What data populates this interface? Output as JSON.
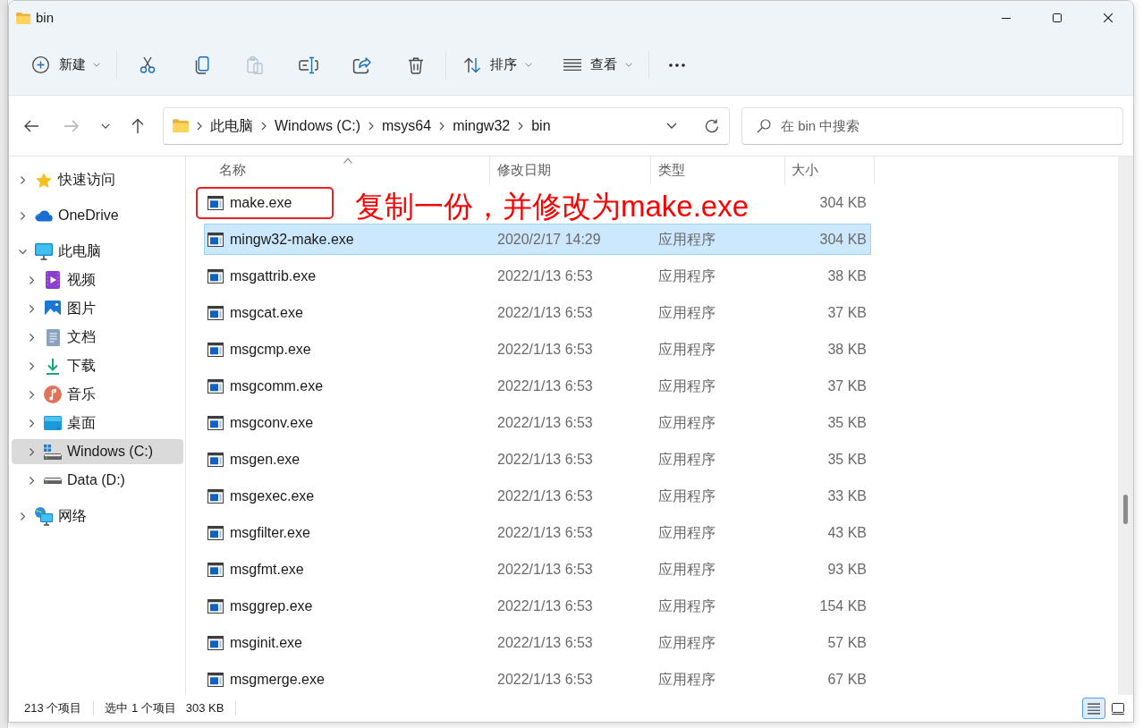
{
  "window": {
    "title": "bin"
  },
  "toolbar": {
    "new_button": {
      "label": "新建"
    },
    "actions": [
      {
        "kind": "cut",
        "disabled": false
      },
      {
        "kind": "copy",
        "disabled": false
      },
      {
        "kind": "paste",
        "disabled": true
      },
      {
        "kind": "rename",
        "disabled": false
      },
      {
        "kind": "share",
        "disabled": false
      },
      {
        "kind": "delete",
        "disabled": false
      }
    ],
    "sort_button": {
      "label": "排序"
    },
    "view_button": {
      "label": "查看"
    }
  },
  "navigation": [
    {
      "kind": "back",
      "disabled": false
    },
    {
      "kind": "forward",
      "disabled": true
    },
    {
      "kind": "recent",
      "disabled": false
    },
    {
      "kind": "up",
      "disabled": false
    }
  ],
  "address_bar": {
    "path": [
      "此电脑",
      "Windows (C:)",
      "msys64",
      "mingw32",
      "bin"
    ]
  },
  "search": {
    "placeholder": "在 bin 中搜索"
  },
  "sidebar": {
    "items": [
      {
        "label": "快速访问",
        "kind": "star",
        "expanded": false,
        "selected": false
      },
      {
        "label": "OneDrive",
        "kind": "cloud",
        "expanded": false,
        "selected": false
      },
      {
        "label": "此电脑",
        "kind": "computer",
        "expanded": true,
        "selected": false,
        "children": [
          {
            "label": "视频",
            "kind": "videos",
            "expanded": false,
            "selected": false
          },
          {
            "label": "图片",
            "kind": "pictures",
            "expanded": false,
            "selected": false
          },
          {
            "label": "文档",
            "kind": "documents",
            "expanded": false,
            "selected": false
          },
          {
            "label": "下载",
            "kind": "downloads",
            "expanded": false,
            "selected": false
          },
          {
            "label": "音乐",
            "kind": "music",
            "expanded": false,
            "selected": false
          },
          {
            "label": "桌面",
            "kind": "desktop",
            "expanded": false,
            "selected": false
          },
          {
            "label": "Windows (C:)",
            "kind": "system_drive",
            "expanded": false,
            "selected": true
          },
          {
            "label": "Data (D:)",
            "kind": "drive",
            "expanded": false,
            "selected": false
          }
        ]
      },
      {
        "label": "网络",
        "kind": "network",
        "expanded": false,
        "selected": false
      }
    ]
  },
  "table": {
    "columns": [
      {
        "label": "名称",
        "sorted": true
      },
      {
        "label": "修改日期",
        "sorted": false
      },
      {
        "label": "类型",
        "sorted": false
      },
      {
        "label": "大小",
        "sorted": false
      }
    ],
    "rows": [
      {
        "name": "make.exe",
        "size": "304 KB",
        "selected": false,
        "highlighted": true
      },
      {
        "name": "mingw32-make.exe",
        "modified": "2020/2/17 14:29",
        "type": "应用程序",
        "size": "304 KB",
        "selected": true,
        "highlighted": false
      },
      {
        "name": "msgattrib.exe",
        "modified": "2022/1/13 6:53",
        "type": "应用程序",
        "size": "38 KB",
        "selected": false,
        "highlighted": false
      },
      {
        "name": "msgcat.exe",
        "modified": "2022/1/13 6:53",
        "type": "应用程序",
        "size": "37 KB",
        "selected": false,
        "highlighted": false
      },
      {
        "name": "msgcmp.exe",
        "modified": "2022/1/13 6:53",
        "type": "应用程序",
        "size": "38 KB",
        "selected": false,
        "highlighted": false
      },
      {
        "name": "msgcomm.exe",
        "modified": "2022/1/13 6:53",
        "type": "应用程序",
        "size": "37 KB",
        "selected": false,
        "highlighted": false
      },
      {
        "name": "msgconv.exe",
        "modified": "2022/1/13 6:53",
        "type": "应用程序",
        "size": "35 KB",
        "selected": false,
        "highlighted": false
      },
      {
        "name": "msgen.exe",
        "modified": "2022/1/13 6:53",
        "type": "应用程序",
        "size": "35 KB",
        "selected": false,
        "highlighted": false
      },
      {
        "name": "msgexec.exe",
        "modified": "2022/1/13 6:53",
        "type": "应用程序",
        "size": "33 KB",
        "selected": false,
        "highlighted": false
      },
      {
        "name": "msgfilter.exe",
        "modified": "2022/1/13 6:53",
        "type": "应用程序",
        "size": "43 KB",
        "selected": false,
        "highlighted": false
      },
      {
        "name": "msgfmt.exe",
        "modified": "2022/1/13 6:53",
        "type": "应用程序",
        "size": "93 KB",
        "selected": false,
        "highlighted": false
      },
      {
        "name": "msggrep.exe",
        "modified": "2022/1/13 6:53",
        "type": "应用程序",
        "size": "154 KB",
        "selected": false,
        "highlighted": false
      },
      {
        "name": "msginit.exe",
        "modified": "2022/1/13 6:53",
        "type": "应用程序",
        "size": "57 KB",
        "selected": false,
        "highlighted": false
      },
      {
        "name": "msgmerge.exe",
        "modified": "2022/1/13 6:53",
        "type": "应用程序",
        "size": "67 KB",
        "selected": false,
        "highlighted": false
      }
    ]
  },
  "annotation": {
    "text": "复制一份，并修改为make.exe"
  },
  "status_bar": {
    "item_count": "213 个项目",
    "selection": "选中 1 个项目",
    "selection_size": "303 KB"
  },
  "view_buttons": [
    {
      "kind": "details",
      "selected": true
    },
    {
      "kind": "tiles",
      "selected": false
    }
  ]
}
